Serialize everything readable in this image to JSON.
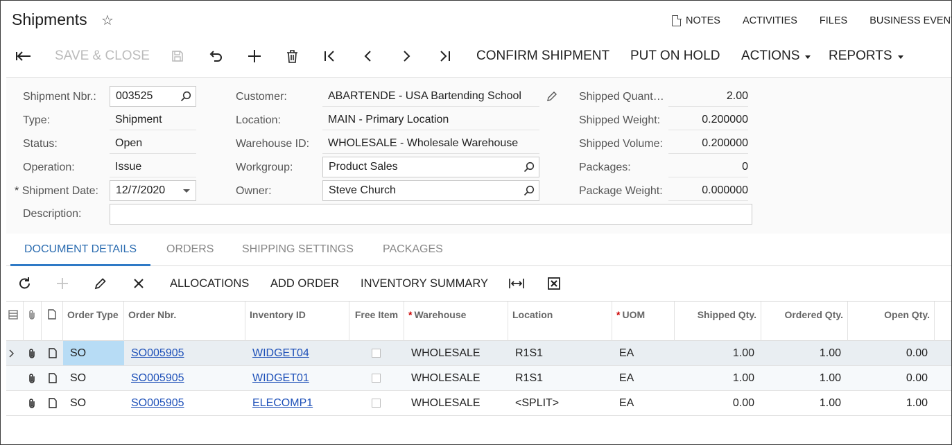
{
  "header": {
    "title": "Shipments",
    "links": {
      "notes": "NOTES",
      "activities": "ACTIVITIES",
      "files": "FILES",
      "business_events": "BUSINESS EVENTS"
    }
  },
  "toolbar": {
    "save_close": "SAVE & CLOSE",
    "confirm_shipment": "CONFIRM SHIPMENT",
    "put_on_hold": "PUT ON HOLD",
    "actions": "ACTIONS",
    "reports": "REPORTS"
  },
  "form": {
    "shipment_nbr_label": "Shipment Nbr.:",
    "shipment_nbr": "003525",
    "type_label": "Type:",
    "type": "Shipment",
    "status_label": "Status:",
    "status": "Open",
    "operation_label": "Operation:",
    "operation": "Issue",
    "required_marker": "*",
    "shipment_date_label": "Shipment Date:",
    "shipment_date": "12/7/2020",
    "description_label": "Description:",
    "description": "",
    "customer_label": "Customer:",
    "customer": "ABARTENDE - USA Bartending School",
    "location_label": "Location:",
    "location": "MAIN - Primary Location",
    "warehouse_label": "Warehouse ID:",
    "warehouse": "WHOLESALE - Wholesale Warehouse",
    "workgroup_label": "Workgroup:",
    "workgroup": "Product Sales",
    "owner_label": "Owner:",
    "owner": "Steve Church",
    "shipped_qty_label": "Shipped Quant…",
    "shipped_qty": "2.00",
    "shipped_weight_label": "Shipped Weight:",
    "shipped_weight": "0.200000",
    "shipped_volume_label": "Shipped Volume:",
    "shipped_volume": "0.200000",
    "packages_label": "Packages:",
    "packages": "0",
    "package_weight_label": "Package Weight:",
    "package_weight": "0.000000"
  },
  "tabs": [
    "DOCUMENT DETAILS",
    "ORDERS",
    "SHIPPING SETTINGS",
    "PACKAGES"
  ],
  "grid_toolbar": {
    "allocations": "ALLOCATIONS",
    "add_order": "ADD ORDER",
    "inventory_summary": "INVENTORY SUMMARY"
  },
  "grid": {
    "req_marker": "*",
    "columns": {
      "order_type": "Order Type",
      "order_nbr": "Order Nbr.",
      "inventory_id": "Inventory ID",
      "free_item": "Free Item",
      "warehouse": "Warehouse",
      "location": "Location",
      "uom": "UOM",
      "shipped_qty": "Shipped Qty.",
      "ordered_qty": "Ordered Qty.",
      "open_qty": "Open Qty."
    },
    "rows": [
      {
        "order_type": "SO",
        "order_nbr": "SO005905",
        "inventory_id": "WIDGET04",
        "warehouse": "WHOLESALE",
        "location": "R1S1",
        "uom": "EA",
        "shipped_qty": "1.00",
        "ordered_qty": "1.00",
        "open_qty": "0.00"
      },
      {
        "order_type": "SO",
        "order_nbr": "SO005905",
        "inventory_id": "WIDGET01",
        "warehouse": "WHOLESALE",
        "location": "R1S1",
        "uom": "EA",
        "shipped_qty": "1.00",
        "ordered_qty": "1.00",
        "open_qty": "0.00"
      },
      {
        "order_type": "SO",
        "order_nbr": "SO005905",
        "inventory_id": "ELECOMP1",
        "warehouse": "WHOLESALE",
        "location": "<SPLIT>",
        "uom": "EA",
        "shipped_qty": "0.00",
        "ordered_qty": "1.00",
        "open_qty": "1.00"
      }
    ]
  }
}
